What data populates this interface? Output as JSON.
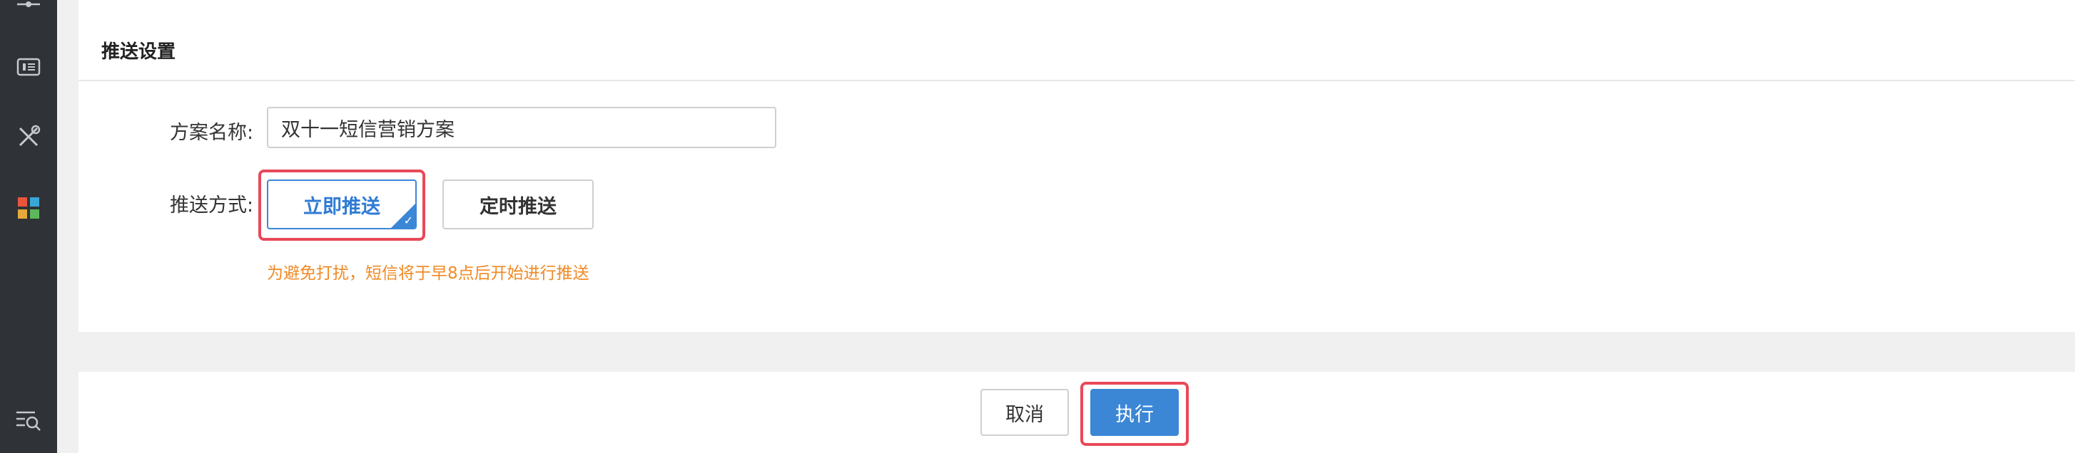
{
  "sidebar": {
    "icons": [
      "slider-icon",
      "ticket-icon",
      "tools-icon",
      "apps-grid-icon",
      "search-list-icon"
    ]
  },
  "push_settings": {
    "title": "推送设置",
    "plan_name_label": "方案名称:",
    "plan_name_value": "双十一短信营销方案",
    "method_label": "推送方式:",
    "options": [
      {
        "label": "立即推送",
        "selected": true
      },
      {
        "label": "定时推送",
        "selected": false
      }
    ],
    "hint": "为避免打扰，短信将于早8点后开始进行推送"
  },
  "footer": {
    "cancel_label": "取消",
    "execute_label": "执行"
  },
  "colors": {
    "primary": "#3b87d6",
    "highlight": "#e8495a",
    "hint": "#f08a24",
    "sidebar": "#2f3236"
  }
}
